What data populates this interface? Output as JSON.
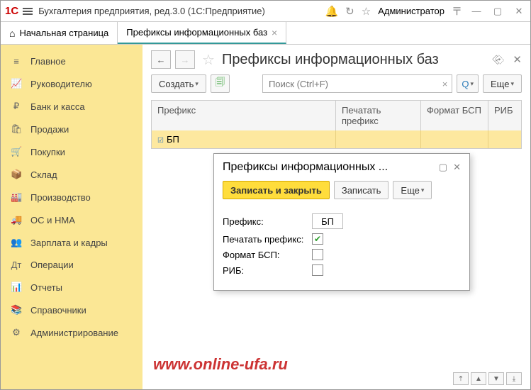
{
  "titlebar": {
    "app_title": "Бухгалтерия предприятия, ред.3.0  (1С:Предприятие)",
    "user": "Администратор"
  },
  "tabs": {
    "home": "Начальная страница",
    "active": "Префиксы информационных баз"
  },
  "sidebar": {
    "items": [
      {
        "icon": "≡",
        "label": "Главное"
      },
      {
        "icon": "📈",
        "label": "Руководителю"
      },
      {
        "icon": "₽",
        "label": "Банк и касса"
      },
      {
        "icon": "🛍",
        "label": "Продажи"
      },
      {
        "icon": "🛒",
        "label": "Покупки"
      },
      {
        "icon": "📦",
        "label": "Склад"
      },
      {
        "icon": "🏭",
        "label": "Производство"
      },
      {
        "icon": "🚚",
        "label": "ОС и НМА"
      },
      {
        "icon": "👥",
        "label": "Зарплата и кадры"
      },
      {
        "icon": "Дт",
        "label": "Операции"
      },
      {
        "icon": "📊",
        "label": "Отчеты"
      },
      {
        "icon": "📚",
        "label": "Справочники"
      },
      {
        "icon": "⚙",
        "label": "Администрирование"
      }
    ]
  },
  "page": {
    "title": "Префиксы информационных баз",
    "create_btn": "Создать",
    "search_placeholder": "Поиск (Ctrl+F)",
    "more_btn": "Еще"
  },
  "table": {
    "headers": {
      "prefix": "Префикс",
      "print": "Печатать префикс",
      "fmt": "Формат БСП",
      "rib": "РИБ"
    },
    "row": {
      "prefix": "БП"
    }
  },
  "dialog": {
    "title": "Префиксы информационных ...",
    "save_close": "Записать и закрыть",
    "save": "Записать",
    "more": "Еще",
    "fields": {
      "prefix_label": "Префикс:",
      "prefix_value": "БП",
      "print_label": "Печатать префикс:",
      "print_checked": true,
      "fmt_label": "Формат БСП:",
      "rib_label": "РИБ:"
    }
  },
  "watermark": "www.online-ufa.ru"
}
